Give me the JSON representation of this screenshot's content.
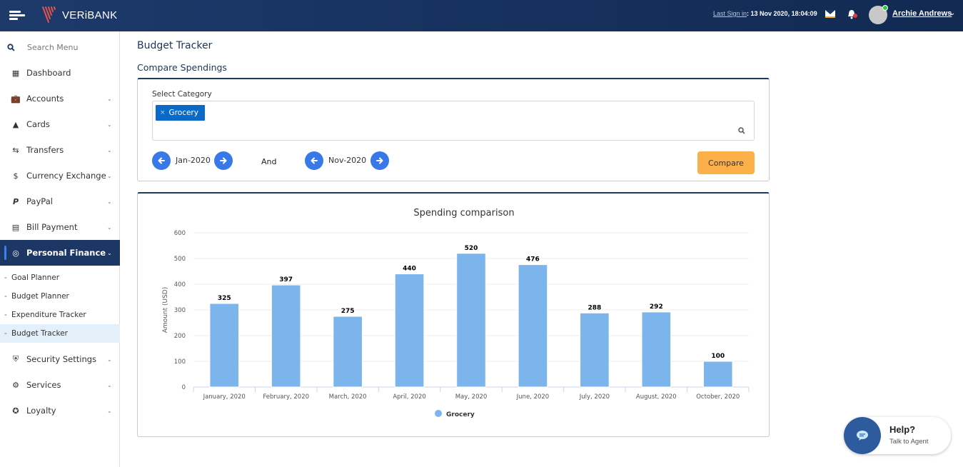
{
  "header": {
    "brand": "VERiBANK",
    "last_sign_in_label": "Last Sign in",
    "last_sign_in_value": ": 13 Nov 2020, 18:04:09",
    "user_name": "Archie Andrews",
    "icons": [
      "menu-icon",
      "mail-icon",
      "bell-icon",
      "avatar",
      "chevron-down-icon"
    ]
  },
  "sidebar": {
    "search_placeholder": "Search Menu",
    "items": [
      {
        "label": "Dashboard",
        "icon": "dashboard-icon",
        "expandable": false
      },
      {
        "label": "Accounts",
        "icon": "briefcase-icon",
        "expandable": true
      },
      {
        "label": "Cards",
        "icon": "card-icon",
        "expandable": true
      },
      {
        "label": "Transfers",
        "icon": "transfer-icon",
        "expandable": true
      },
      {
        "label": "Currency Exchange",
        "icon": "currency-icon",
        "expandable": true
      },
      {
        "label": "PayPal",
        "icon": "paypal-icon",
        "expandable": true
      },
      {
        "label": "Bill Payment",
        "icon": "bill-icon",
        "expandable": true
      },
      {
        "label": "Personal Finance",
        "icon": "target-icon",
        "expandable": true,
        "active": true
      },
      {
        "label": "Security Settings",
        "icon": "shield-icon",
        "expandable": true
      },
      {
        "label": "Services",
        "icon": "gears-icon",
        "expandable": true
      },
      {
        "label": "Loyalty",
        "icon": "award-icon",
        "expandable": true
      }
    ],
    "sub_items": [
      {
        "label": "Goal Planner"
      },
      {
        "label": "Budget Planner"
      },
      {
        "label": "Expenditure Tracker"
      },
      {
        "label": "Budget Tracker",
        "active": true
      }
    ]
  },
  "main": {
    "page_title": "Budget Tracker",
    "section_title": "Compare Spendings",
    "select_category_label": "Select Category",
    "selected_chips": [
      "Grocery"
    ],
    "chip_remove": "×",
    "period_from": "Jan-2020",
    "and_label": "And",
    "period_to": "Nov-2020",
    "compare_button": "Compare"
  },
  "chart_data": {
    "type": "bar",
    "title": "Spending comparison",
    "xlabel": "",
    "ylabel": "Amount (USD)",
    "categories": [
      "January, 2020",
      "February, 2020",
      "March, 2020",
      "April, 2020",
      "May, 2020",
      "June, 2020",
      "July, 2020",
      "August, 2020",
      "October, 2020"
    ],
    "series": [
      {
        "name": "Grocery",
        "color": "#7cb5ec",
        "values": [
          325,
          397,
          275,
          440,
          520,
          476,
          288,
          292,
          100
        ]
      }
    ],
    "ylim": [
      0,
      600
    ],
    "yticks": [
      0,
      100,
      200,
      300,
      400,
      500,
      600
    ],
    "grid": true,
    "data_labels": true,
    "legend": "bottom-center"
  },
  "help": {
    "title": "Help?",
    "subtitle": "Talk to Agent"
  },
  "colors": {
    "header_bg": "#1a3563",
    "active_nav": "#1c3764",
    "accent_blue": "#3978e8",
    "chip_blue": "#0b69c7",
    "compare_orange": "#fdb049",
    "bar_color": "#7cb5ec"
  }
}
